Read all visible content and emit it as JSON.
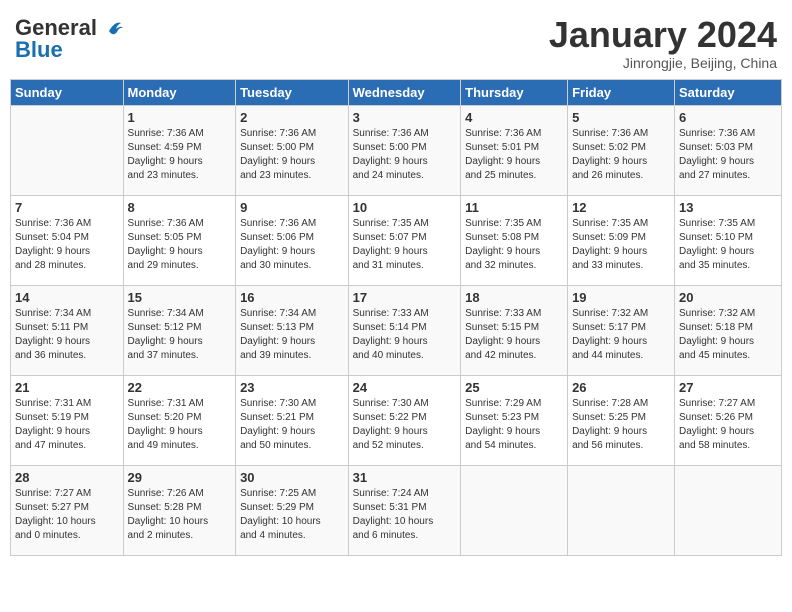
{
  "header": {
    "logo_general": "General",
    "logo_blue": "Blue",
    "month_title": "January 2024",
    "subtitle": "Jinrongjie, Beijing, China"
  },
  "weekdays": [
    "Sunday",
    "Monday",
    "Tuesday",
    "Wednesday",
    "Thursday",
    "Friday",
    "Saturday"
  ],
  "weeks": [
    [
      {
        "day": "",
        "info": ""
      },
      {
        "day": "1",
        "info": "Sunrise: 7:36 AM\nSunset: 4:59 PM\nDaylight: 9 hours\nand 23 minutes."
      },
      {
        "day": "2",
        "info": "Sunrise: 7:36 AM\nSunset: 5:00 PM\nDaylight: 9 hours\nand 23 minutes."
      },
      {
        "day": "3",
        "info": "Sunrise: 7:36 AM\nSunset: 5:00 PM\nDaylight: 9 hours\nand 24 minutes."
      },
      {
        "day": "4",
        "info": "Sunrise: 7:36 AM\nSunset: 5:01 PM\nDaylight: 9 hours\nand 25 minutes."
      },
      {
        "day": "5",
        "info": "Sunrise: 7:36 AM\nSunset: 5:02 PM\nDaylight: 9 hours\nand 26 minutes."
      },
      {
        "day": "6",
        "info": "Sunrise: 7:36 AM\nSunset: 5:03 PM\nDaylight: 9 hours\nand 27 minutes."
      }
    ],
    [
      {
        "day": "7",
        "info": "Sunrise: 7:36 AM\nSunset: 5:04 PM\nDaylight: 9 hours\nand 28 minutes."
      },
      {
        "day": "8",
        "info": "Sunrise: 7:36 AM\nSunset: 5:05 PM\nDaylight: 9 hours\nand 29 minutes."
      },
      {
        "day": "9",
        "info": "Sunrise: 7:36 AM\nSunset: 5:06 PM\nDaylight: 9 hours\nand 30 minutes."
      },
      {
        "day": "10",
        "info": "Sunrise: 7:35 AM\nSunset: 5:07 PM\nDaylight: 9 hours\nand 31 minutes."
      },
      {
        "day": "11",
        "info": "Sunrise: 7:35 AM\nSunset: 5:08 PM\nDaylight: 9 hours\nand 32 minutes."
      },
      {
        "day": "12",
        "info": "Sunrise: 7:35 AM\nSunset: 5:09 PM\nDaylight: 9 hours\nand 33 minutes."
      },
      {
        "day": "13",
        "info": "Sunrise: 7:35 AM\nSunset: 5:10 PM\nDaylight: 9 hours\nand 35 minutes."
      }
    ],
    [
      {
        "day": "14",
        "info": "Sunrise: 7:34 AM\nSunset: 5:11 PM\nDaylight: 9 hours\nand 36 minutes."
      },
      {
        "day": "15",
        "info": "Sunrise: 7:34 AM\nSunset: 5:12 PM\nDaylight: 9 hours\nand 37 minutes."
      },
      {
        "day": "16",
        "info": "Sunrise: 7:34 AM\nSunset: 5:13 PM\nDaylight: 9 hours\nand 39 minutes."
      },
      {
        "day": "17",
        "info": "Sunrise: 7:33 AM\nSunset: 5:14 PM\nDaylight: 9 hours\nand 40 minutes."
      },
      {
        "day": "18",
        "info": "Sunrise: 7:33 AM\nSunset: 5:15 PM\nDaylight: 9 hours\nand 42 minutes."
      },
      {
        "day": "19",
        "info": "Sunrise: 7:32 AM\nSunset: 5:17 PM\nDaylight: 9 hours\nand 44 minutes."
      },
      {
        "day": "20",
        "info": "Sunrise: 7:32 AM\nSunset: 5:18 PM\nDaylight: 9 hours\nand 45 minutes."
      }
    ],
    [
      {
        "day": "21",
        "info": "Sunrise: 7:31 AM\nSunset: 5:19 PM\nDaylight: 9 hours\nand 47 minutes."
      },
      {
        "day": "22",
        "info": "Sunrise: 7:31 AM\nSunset: 5:20 PM\nDaylight: 9 hours\nand 49 minutes."
      },
      {
        "day": "23",
        "info": "Sunrise: 7:30 AM\nSunset: 5:21 PM\nDaylight: 9 hours\nand 50 minutes."
      },
      {
        "day": "24",
        "info": "Sunrise: 7:30 AM\nSunset: 5:22 PM\nDaylight: 9 hours\nand 52 minutes."
      },
      {
        "day": "25",
        "info": "Sunrise: 7:29 AM\nSunset: 5:23 PM\nDaylight: 9 hours\nand 54 minutes."
      },
      {
        "day": "26",
        "info": "Sunrise: 7:28 AM\nSunset: 5:25 PM\nDaylight: 9 hours\nand 56 minutes."
      },
      {
        "day": "27",
        "info": "Sunrise: 7:27 AM\nSunset: 5:26 PM\nDaylight: 9 hours\nand 58 minutes."
      }
    ],
    [
      {
        "day": "28",
        "info": "Sunrise: 7:27 AM\nSunset: 5:27 PM\nDaylight: 10 hours\nand 0 minutes."
      },
      {
        "day": "29",
        "info": "Sunrise: 7:26 AM\nSunset: 5:28 PM\nDaylight: 10 hours\nand 2 minutes."
      },
      {
        "day": "30",
        "info": "Sunrise: 7:25 AM\nSunset: 5:29 PM\nDaylight: 10 hours\nand 4 minutes."
      },
      {
        "day": "31",
        "info": "Sunrise: 7:24 AM\nSunset: 5:31 PM\nDaylight: 10 hours\nand 6 minutes."
      },
      {
        "day": "",
        "info": ""
      },
      {
        "day": "",
        "info": ""
      },
      {
        "day": "",
        "info": ""
      }
    ]
  ]
}
